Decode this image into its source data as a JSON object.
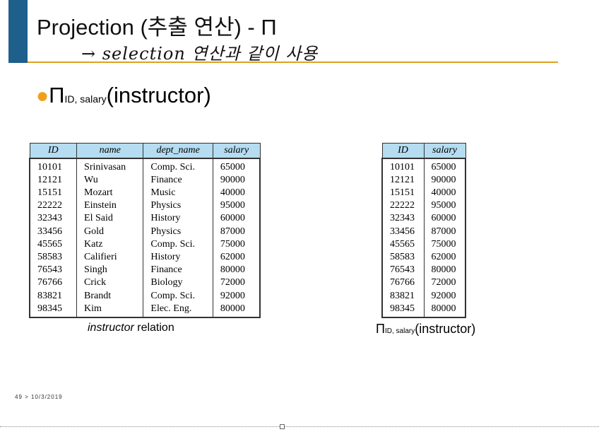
{
  "slide": {
    "title": "Projection (추출 연산) - Π",
    "handwritten_note": "→ selection 연산과 같이 사용",
    "bullet": {
      "symbol": "Π",
      "subscript": "ID, salary",
      "argument": "(instructor)"
    },
    "footer": "49  >  10/3/2019"
  },
  "instructor_table": {
    "headers": [
      "ID",
      "name",
      "dept_name",
      "salary"
    ],
    "rows": [
      [
        "10101",
        "Srinivasan",
        "Comp. Sci.",
        "65000"
      ],
      [
        "12121",
        "Wu",
        "Finance",
        "90000"
      ],
      [
        "15151",
        "Mozart",
        "Music",
        "40000"
      ],
      [
        "22222",
        "Einstein",
        "Physics",
        "95000"
      ],
      [
        "32343",
        "El Said",
        "History",
        "60000"
      ],
      [
        "33456",
        "Gold",
        "Physics",
        "87000"
      ],
      [
        "45565",
        "Katz",
        "Comp. Sci.",
        "75000"
      ],
      [
        "58583",
        "Califieri",
        "History",
        "62000"
      ],
      [
        "76543",
        "Singh",
        "Finance",
        "80000"
      ],
      [
        "76766",
        "Crick",
        "Biology",
        "72000"
      ],
      [
        "83821",
        "Brandt",
        "Comp. Sci.",
        "92000"
      ],
      [
        "98345",
        "Kim",
        "Elec. Eng.",
        "80000"
      ]
    ],
    "caption_italic": "instructor",
    "caption_rest": " relation"
  },
  "projection_table": {
    "headers": [
      "ID",
      "salary"
    ],
    "rows": [
      [
        "10101",
        "65000"
      ],
      [
        "12121",
        "90000"
      ],
      [
        "15151",
        "40000"
      ],
      [
        "22222",
        "95000"
      ],
      [
        "32343",
        "60000"
      ],
      [
        "33456",
        "87000"
      ],
      [
        "45565",
        "75000"
      ],
      [
        "58583",
        "62000"
      ],
      [
        "76543",
        "80000"
      ],
      [
        "76766",
        "72000"
      ],
      [
        "83821",
        "92000"
      ],
      [
        "98345",
        "80000"
      ]
    ],
    "caption_symbol": "Π",
    "caption_subscript": "ID, salary",
    "caption_argument": "(instructor)"
  }
}
